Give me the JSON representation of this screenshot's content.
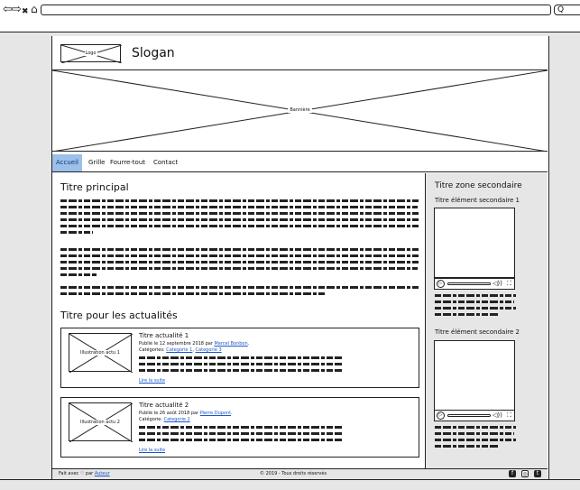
{
  "browser": {
    "back_icon": "⇦",
    "forward_icon": "⇨",
    "close_icon": "✖",
    "home_icon": "⌂",
    "search_icon": "Q"
  },
  "header": {
    "logo_label": "Logo",
    "slogan": "Slogan"
  },
  "banner": {
    "label": "Bannière"
  },
  "menu": {
    "items": [
      {
        "label": "Accueil"
      },
      {
        "label": "Grille"
      },
      {
        "label": "Fourre-tout"
      },
      {
        "label": "Contact"
      }
    ]
  },
  "main": {
    "title": "Titre principal",
    "news_title": "Titre pour les actualités",
    "articles": [
      {
        "thumb_label": "Illustration actu 1",
        "title": "Titre actualité 1",
        "published_prefix": "Publié le 12 septembre 2018 par ",
        "author": "Marcel Bonbon",
        "categories_prefix": "Catégories: ",
        "category_1": "Categorie 1",
        "category_sep": ", ",
        "category_2": "Categorie 3",
        "read_more": "Lire la suite"
      },
      {
        "thumb_label": "Illustration actu 2",
        "title": "Titre actualité 2",
        "published_prefix": "Publié le 26 août 2018 par ",
        "author": "Pierre Dupont",
        "categories_prefix": "Catégorie: ",
        "category_1": "Categorie 2",
        "read_more": "Lire la suite"
      }
    ]
  },
  "sidebar": {
    "title": "Titre zone secondaire",
    "element_1_title": "Titre élément secondaire 1",
    "element_2_title": "Titre élément secondaire 2",
    "play_icon": "▷",
    "volume_icon": "◁))",
    "fullscreen_icon": "⛶"
  },
  "footer": {
    "made_with_prefix": "Fait avec ♡ par ",
    "author_link": "Auteur",
    "copyright": "© 2019 - Tous droits réservés",
    "social": [
      "f",
      "◎",
      "t"
    ]
  },
  "colors": {
    "active_tab_bg": "#9cc0ea",
    "link": "#1b56c9",
    "gray_bg": "#e6e6e6"
  }
}
